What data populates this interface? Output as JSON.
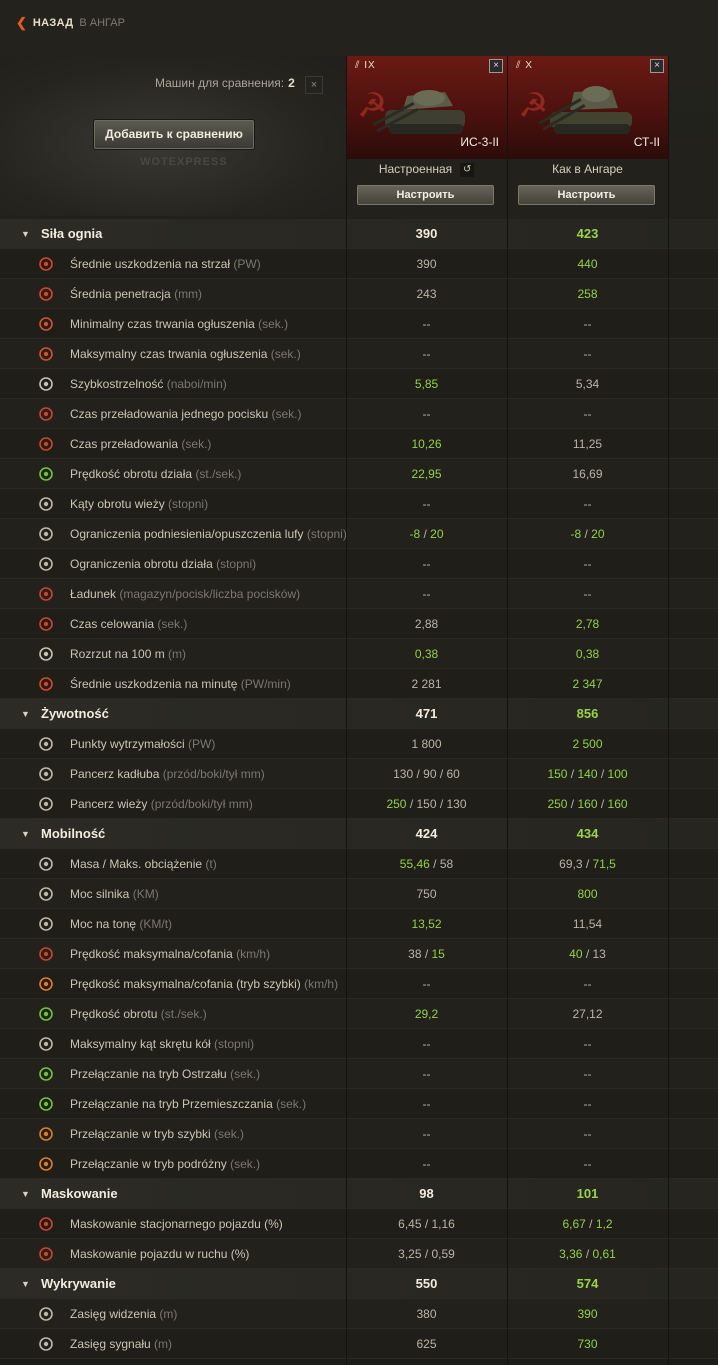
{
  "nav": {
    "back": "НАЗАД",
    "crumb": "В АНГАР"
  },
  "header": {
    "compare_label": "Машин для сравнения:",
    "compare_count": "2",
    "clear": "×",
    "add_button": "Добавить к сравнению",
    "watermark": "WOTEXPRESS"
  },
  "tanks": [
    {
      "tier": "IX",
      "name": "ИС-3-II",
      "config": "Настроенная",
      "tune": "Настроить",
      "close": "×"
    },
    {
      "tier": "X",
      "name": "СТ-II",
      "config": "Как в Ангаре",
      "tune": "Настроить",
      "close": "×"
    }
  ],
  "rows": [
    {
      "type": "sec",
      "label": "Siła ognia",
      "v1": [
        [
          "390",
          ""
        ]
      ],
      "v2": [
        [
          "423",
          "g"
        ]
      ]
    },
    {
      "type": "sub",
      "icon": "damage-icon",
      "ic": "#e0422a",
      "label": "Średnie uszkodzenia na strzał",
      "unit": "(PW)",
      "v1": [
        [
          "390",
          ""
        ]
      ],
      "v2": [
        [
          "440",
          "g"
        ]
      ]
    },
    {
      "type": "sub",
      "icon": "penetration-icon",
      "ic": "#e0422a",
      "label": "Średnia penetracja",
      "unit": "(mm)",
      "v1": [
        [
          "243",
          ""
        ]
      ],
      "v2": [
        [
          "258",
          "g"
        ]
      ]
    },
    {
      "type": "sub",
      "icon": "stun-min-icon",
      "ic": "#d8502b",
      "label": "Minimalny czas trwania ogłuszenia",
      "unit": "(sek.)",
      "v1": [
        [
          "--",
          ""
        ]
      ],
      "v2": [
        [
          "--",
          ""
        ]
      ]
    },
    {
      "type": "sub",
      "icon": "stun-max-icon",
      "ic": "#d8502b",
      "label": "Maksymalny czas trwania ogłuszenia",
      "unit": "(sek.)",
      "v1": [
        [
          "--",
          ""
        ]
      ],
      "v2": [
        [
          "--",
          ""
        ]
      ]
    },
    {
      "type": "sub",
      "icon": "rate-of-fire-icon",
      "ic": "#c6c2b5",
      "label": "Szybkostrzelność",
      "unit": "(naboi/min)",
      "v1": [
        [
          "5,85",
          "g"
        ]
      ],
      "v2": [
        [
          "5,34",
          ""
        ]
      ]
    },
    {
      "type": "sub",
      "icon": "shell-reload-icon",
      "ic": "#d0432b",
      "label": "Czas przeładowania jednego pocisku",
      "unit": "(sek.)",
      "v1": [
        [
          "--",
          ""
        ]
      ],
      "v2": [
        [
          "--",
          ""
        ]
      ]
    },
    {
      "type": "sub",
      "icon": "reload-icon",
      "ic": "#d0432b",
      "label": "Czas przeładowania",
      "unit": "(sek.)",
      "v1": [
        [
          "10,26",
          "g"
        ]
      ],
      "v2": [
        [
          "11,25",
          ""
        ]
      ]
    },
    {
      "type": "sub",
      "icon": "gun-traverse-icon",
      "ic": "#6ec43a",
      "label": "Prędkość obrotu działa",
      "unit": "(st./sek.)",
      "v1": [
        [
          "22,95",
          "g"
        ]
      ],
      "v2": [
        [
          "16,69",
          ""
        ]
      ]
    },
    {
      "type": "sub",
      "icon": "turret-angles-icon",
      "ic": "#bcb8aa",
      "label": "Kąty obrotu wieży",
      "unit": "(stopni)",
      "v1": [
        [
          "--",
          ""
        ]
      ],
      "v2": [
        [
          "--",
          ""
        ]
      ]
    },
    {
      "type": "sub",
      "icon": "elevation-icon",
      "ic": "#bcb8aa",
      "label": "Ograniczenia podniesienia/opuszczenia lufy",
      "unit": "(stopni)",
      "v1": [
        [
          "-8",
          "g"
        ],
        [
          " / ",
          ""
        ],
        [
          "20",
          "g"
        ]
      ],
      "v2": [
        [
          "-8",
          "g"
        ],
        [
          " / ",
          ""
        ],
        [
          "20",
          "g"
        ]
      ]
    },
    {
      "type": "sub",
      "icon": "gun-arc-icon",
      "ic": "#bcb8aa",
      "label": "Ograniczenia obrotu działa",
      "unit": "(stopni)",
      "v1": [
        [
          "--",
          ""
        ]
      ],
      "v2": [
        [
          "--",
          ""
        ]
      ]
    },
    {
      "type": "sub",
      "icon": "ammo-icon",
      "ic": "#d0432b",
      "label": "Ładunek",
      "unit": "(magazyn/pocisk/liczba pocisków)",
      "v1": [
        [
          "--",
          ""
        ]
      ],
      "v2": [
        [
          "--",
          ""
        ]
      ]
    },
    {
      "type": "sub",
      "icon": "aim-time-icon",
      "ic": "#d0432b",
      "label": "Czas celowania",
      "unit": "(sek.)",
      "v1": [
        [
          "2,88",
          ""
        ]
      ],
      "v2": [
        [
          "2,78",
          "g"
        ]
      ]
    },
    {
      "type": "sub",
      "icon": "dispersion-icon",
      "ic": "#c6c2b5",
      "label": "Rozrzut na 100 m",
      "unit": "(m)",
      "v1": [
        [
          "0,38",
          "g"
        ]
      ],
      "v2": [
        [
          "0,38",
          "g"
        ]
      ]
    },
    {
      "type": "sub",
      "icon": "dpm-icon",
      "ic": "#e0422a",
      "label": "Średnie uszkodzenia na minutę",
      "unit": "(PW/min)",
      "v1": [
        [
          "2 281",
          ""
        ]
      ],
      "v2": [
        [
          "2 347",
          "g"
        ]
      ]
    },
    {
      "type": "sec",
      "label": "Żywotność",
      "v1": [
        [
          "471",
          ""
        ]
      ],
      "v2": [
        [
          "856",
          "g"
        ]
      ]
    },
    {
      "type": "sub",
      "icon": "hit-points-icon",
      "ic": "#bcb8aa",
      "label": "Punkty wytrzymałości",
      "unit": "(PW)",
      "v1": [
        [
          "1 800",
          ""
        ]
      ],
      "v2": [
        [
          "2 500",
          "g"
        ]
      ]
    },
    {
      "type": "sub",
      "icon": "hull-armor-icon",
      "ic": "#bcb8aa",
      "label": "Pancerz kadłuba",
      "unit": "(przód/boki/tył mm)",
      "v1": [
        [
          "130 / 90 / 60",
          ""
        ]
      ],
      "v2": [
        [
          "150",
          "g"
        ],
        [
          " / ",
          ""
        ],
        [
          "140",
          "g"
        ],
        [
          " / ",
          ""
        ],
        [
          "100",
          "g"
        ]
      ]
    },
    {
      "type": "sub",
      "icon": "turret-armor-icon",
      "ic": "#bcb8aa",
      "label": "Pancerz wieży",
      "unit": "(przód/boki/tył mm)",
      "v1": [
        [
          "250",
          "g"
        ],
        [
          " / 150 / 130",
          ""
        ]
      ],
      "v2": [
        [
          "250",
          "g"
        ],
        [
          " / ",
          ""
        ],
        [
          "160",
          "g"
        ],
        [
          " / ",
          ""
        ],
        [
          "160",
          "g"
        ]
      ]
    },
    {
      "type": "sec",
      "label": "Mobilność",
      "v1": [
        [
          "424",
          ""
        ]
      ],
      "v2": [
        [
          "434",
          "g"
        ]
      ]
    },
    {
      "type": "sub",
      "icon": "weight-icon",
      "ic": "#bcb8aa",
      "label": "Masa / Maks. obciążenie",
      "unit": "(t)",
      "v1": [
        [
          "55,46",
          "g"
        ],
        [
          " / 58",
          ""
        ]
      ],
      "v2": [
        [
          "69,3 / ",
          ""
        ],
        [
          "71,5",
          "g"
        ]
      ]
    },
    {
      "type": "sub",
      "icon": "engine-power-icon",
      "ic": "#bcb8aa",
      "label": "Moc silnika",
      "unit": "(KM)",
      "v1": [
        [
          "750",
          ""
        ]
      ],
      "v2": [
        [
          "800",
          "g"
        ]
      ]
    },
    {
      "type": "sub",
      "icon": "power-weight-icon",
      "ic": "#bcb8aa",
      "label": "Moc na tonę",
      "unit": "(KM/t)",
      "v1": [
        [
          "13,52",
          "g"
        ]
      ],
      "v2": [
        [
          "11,54",
          ""
        ]
      ]
    },
    {
      "type": "sub",
      "icon": "speed-icon",
      "ic": "#d0432b",
      "label": "Prędkość maksymalna/cofania",
      "unit": "(km/h)",
      "v1": [
        [
          "38 / ",
          ""
        ],
        [
          "15",
          "g"
        ]
      ],
      "v2": [
        [
          "40",
          "g"
        ],
        [
          " / 13",
          ""
        ]
      ]
    },
    {
      "type": "sub",
      "icon": "fast-speed-icon",
      "ic": "#e37a2b",
      "label": "Prędkość maksymalna/cofania (tryb szybki)",
      "unit": "(km/h)",
      "v1": [
        [
          "--",
          ""
        ]
      ],
      "v2": [
        [
          "--",
          ""
        ]
      ]
    },
    {
      "type": "sub",
      "icon": "hull-traverse-icon",
      "ic": "#6ec43a",
      "label": "Prędkość obrotu",
      "unit": "(st./sek.)",
      "v1": [
        [
          "29,2",
          "g"
        ]
      ],
      "v2": [
        [
          "27,12",
          ""
        ]
      ]
    },
    {
      "type": "sub",
      "icon": "steering-angle-icon",
      "ic": "#bcb8aa",
      "label": "Maksymalny kąt skrętu kół",
      "unit": "(stopni)",
      "v1": [
        [
          "--",
          ""
        ]
      ],
      "v2": [
        [
          "--",
          ""
        ]
      ]
    },
    {
      "type": "sub",
      "icon": "siege-mode-icon",
      "ic": "#6ec43a",
      "label": "Przełączanie na tryb Ostrzału",
      "unit": " (sek.)",
      "v1": [
        [
          "--",
          ""
        ]
      ],
      "v2": [
        [
          "--",
          ""
        ]
      ]
    },
    {
      "type": "sub",
      "icon": "travel-mode-icon",
      "ic": "#6ec43a",
      "label": "Przełączanie na tryb Przemieszczania",
      "unit": " (sek.)",
      "v1": [
        [
          "--",
          ""
        ]
      ],
      "v2": [
        [
          "--",
          ""
        ]
      ]
    },
    {
      "type": "sub",
      "icon": "fast-mode-icon",
      "ic": "#e37a2b",
      "label": "Przełączanie w tryb szybki",
      "unit": "(sek.)",
      "v1": [
        [
          "--",
          ""
        ]
      ],
      "v2": [
        [
          "--",
          ""
        ]
      ]
    },
    {
      "type": "sub",
      "icon": "cruise-mode-icon",
      "ic": "#e37a2b",
      "label": "Przełączanie w tryb podróżny",
      "unit": "(sek.)",
      "v1": [
        [
          "--",
          ""
        ]
      ],
      "v2": [
        [
          "--",
          ""
        ]
      ]
    },
    {
      "type": "sec",
      "label": "Maskowanie",
      "v1": [
        [
          "98",
          ""
        ]
      ],
      "v2": [
        [
          "101",
          "g"
        ]
      ]
    },
    {
      "type": "sub",
      "icon": "camo-stationary-icon",
      "ic": "#d0432b",
      "label": "Maskowanie stacjonarnego pojazdu",
      "unit": "(%)",
      "unitStyle": "plain",
      "v1": [
        [
          "6,45 / 1,16",
          ""
        ]
      ],
      "v2": [
        [
          "6,67",
          "g"
        ],
        [
          " / ",
          ""
        ],
        [
          "1,2",
          "g"
        ]
      ]
    },
    {
      "type": "sub",
      "icon": "camo-moving-icon",
      "ic": "#d0432b",
      "label": "Maskowanie pojazdu w ruchu",
      "unit": "(%)",
      "unitStyle": "plain",
      "v1": [
        [
          "3,25 / 0,59",
          ""
        ]
      ],
      "v2": [
        [
          "3,36",
          "g"
        ],
        [
          " / ",
          ""
        ],
        [
          "0,61",
          "g"
        ]
      ]
    },
    {
      "type": "sec",
      "label": "Wykrywanie",
      "v1": [
        [
          "550",
          ""
        ]
      ],
      "v2": [
        [
          "574",
          "g"
        ]
      ]
    },
    {
      "type": "sub",
      "icon": "view-range-icon",
      "ic": "#bcb8aa",
      "label": "Zasięg widzenia",
      "unit": "(m)",
      "v1": [
        [
          "380",
          ""
        ]
      ],
      "v2": [
        [
          "390",
          "g"
        ]
      ]
    },
    {
      "type": "sub",
      "icon": "signal-range-icon",
      "ic": "#bcb8aa",
      "label": "Zasięg sygnału",
      "unit": "(m)",
      "v1": [
        [
          "625",
          ""
        ]
      ],
      "v2": [
        [
          "730",
          "g"
        ]
      ]
    }
  ]
}
